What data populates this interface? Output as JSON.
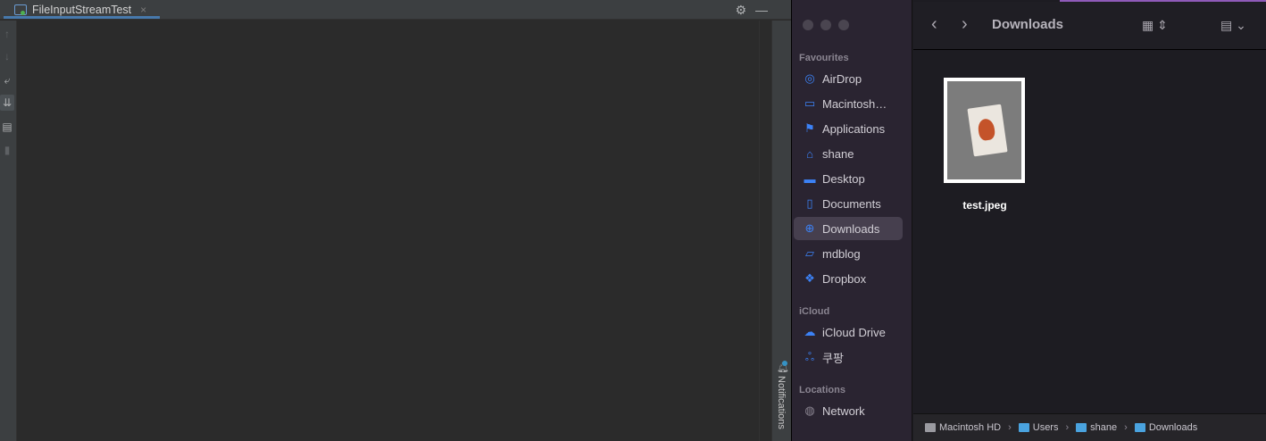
{
  "ide": {
    "tab_label": "FileInputStreamTest",
    "tab_close": "×",
    "settings_icon": "⚙",
    "minimize_icon": "—",
    "notifications_label": "Notifications",
    "gutter_icons": [
      "arrow-up-icon",
      "arrow-down-icon",
      "soft-wrap-icon",
      "scroll-to-end-icon",
      "print-icon",
      "trash-icon"
    ]
  },
  "finder": {
    "title": "Downloads",
    "sidebar": {
      "favourites_header": "Favourites",
      "favourites": [
        {
          "label": "AirDrop",
          "icon": "airdrop-icon"
        },
        {
          "label": "Macintosh…",
          "icon": "disk-icon"
        },
        {
          "label": "Applications",
          "icon": "applications-icon"
        },
        {
          "label": "shane",
          "icon": "home-icon"
        },
        {
          "label": "Desktop",
          "icon": "desktop-icon"
        },
        {
          "label": "Documents",
          "icon": "document-icon"
        },
        {
          "label": "Downloads",
          "icon": "downloads-icon",
          "selected": true
        },
        {
          "label": "mdblog",
          "icon": "folder-icon"
        },
        {
          "label": "Dropbox",
          "icon": "dropbox-icon"
        }
      ],
      "icloud_header": "iCloud",
      "icloud": [
        {
          "label": "iCloud Drive",
          "icon": "cloud-icon"
        },
        {
          "label": "쿠팡",
          "icon": "shared-icon"
        }
      ],
      "locations_header": "Locations",
      "locations": [
        {
          "label": "Network",
          "icon": "network-icon"
        }
      ]
    },
    "files": [
      {
        "name": "test.jpeg"
      }
    ],
    "path": [
      "Macintosh HD",
      "Users",
      "shane",
      "Downloads"
    ]
  },
  "colors": {
    "accent": "#3c82f6",
    "selected_row": "#463f4e",
    "ide_bg": "#2b2b2b"
  }
}
